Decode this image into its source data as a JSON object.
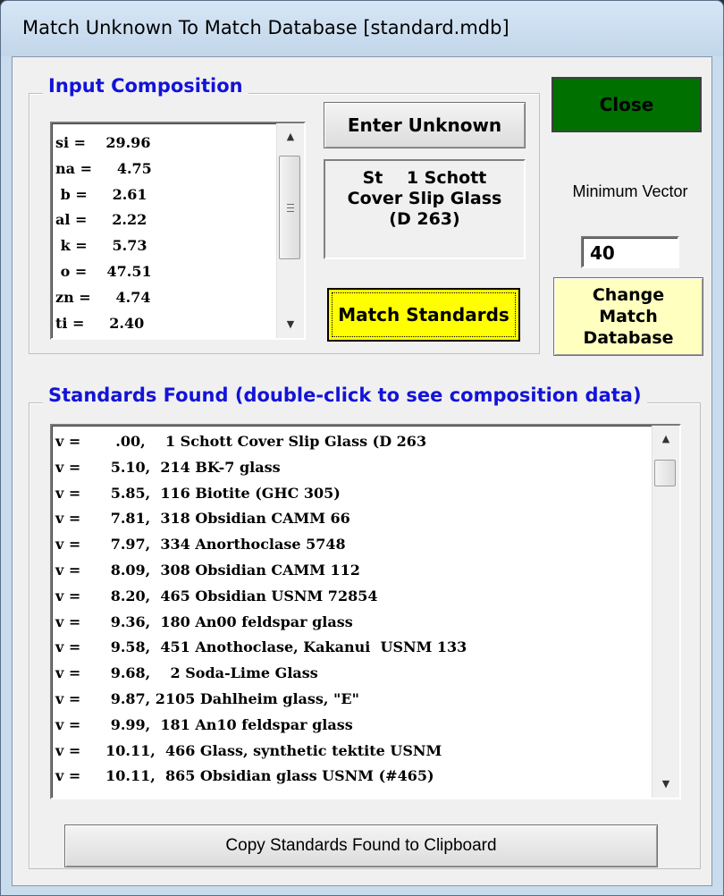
{
  "window": {
    "title": "Match Unknown To Match Database [standard.mdb]"
  },
  "input_composition": {
    "label": "Input Composition",
    "lines": [
      "si =    29.96",
      "na =     4.75",
      " b =     2.61",
      "al =     2.22",
      " k =     5.73",
      " o =    47.51",
      "zn =     4.74",
      "ti =     2.40"
    ]
  },
  "buttons": {
    "enter_unknown": "Enter Unknown",
    "match_standards": "Match Standards",
    "close": "Close",
    "change_db_line1": "Change",
    "change_db_line2": "Match",
    "change_db_line3": "Database",
    "copy": "Copy Standards Found to Clipboard"
  },
  "selected_standard": {
    "line1": "St    1 Schott",
    "line2": "Cover Slip Glass",
    "line3": "(D 263)"
  },
  "minimum_vector": {
    "label": "Minimum Vector",
    "value": "40"
  },
  "standards_found": {
    "label": "Standards Found (double-click to see composition data)",
    "lines": [
      "v =       .00,    1 Schott Cover Slip Glass (D 263",
      "v =      5.10,  214 BK-7 glass",
      "v =      5.85,  116 Biotite (GHC 305)",
      "v =      7.81,  318 Obsidian CAMM 66",
      "v =      7.97,  334 Anorthoclase 5748",
      "v =      8.09,  308 Obsidian CAMM 112",
      "v =      8.20,  465 Obsidian USNM 72854",
      "v =      9.36,  180 An00 feldspar glass",
      "v =      9.58,  451 Anothoclase, Kakanui  USNM 133",
      "v =      9.68,    2 Soda-Lime Glass",
      "v =      9.87, 2105 Dahlheim glass, \"E\"",
      "v =      9.99,  181 An10 feldspar glass",
      "v =     10.11,  466 Glass, synthetic tektite USNM",
      "v =     10.11,  865 Obsidian glass USNM (#465)"
    ]
  },
  "colors": {
    "close_button": "#007000",
    "match_button": "#ffff00",
    "change_db_button": "#ffffc0",
    "group_label": "#1313d8"
  }
}
